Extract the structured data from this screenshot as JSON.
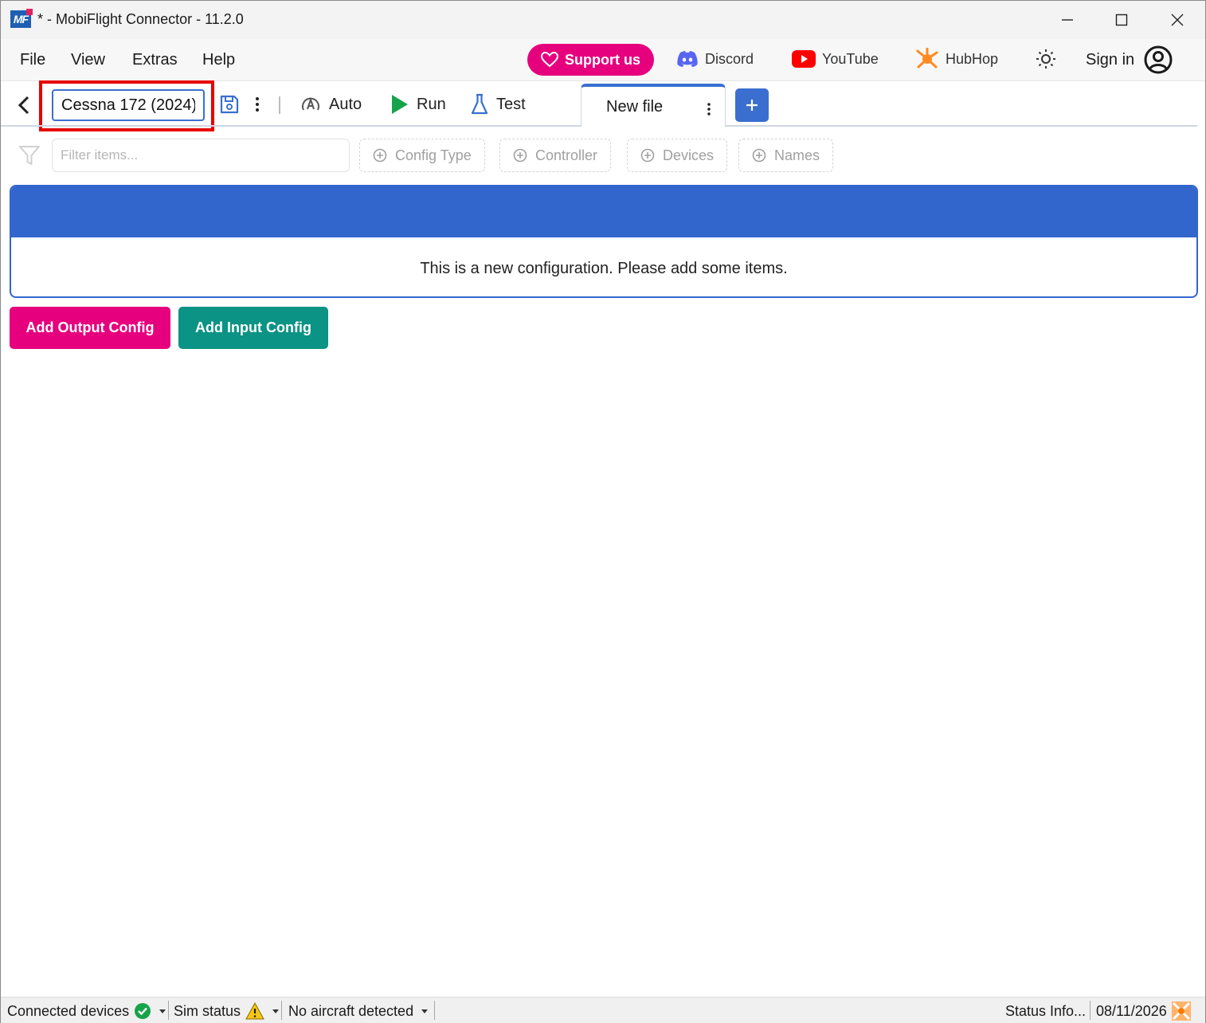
{
  "window": {
    "title": "* - MobiFlight Connector - 11.2.0",
    "logo_text": "MF"
  },
  "menu": {
    "items": [
      "File",
      "View",
      "Extras",
      "Help"
    ],
    "support_label": "Support us",
    "links": [
      {
        "label": "Discord",
        "icon": "discord-icon"
      },
      {
        "label": "YouTube",
        "icon": "youtube-icon"
      },
      {
        "label": "HubHop",
        "icon": "hubhop-icon"
      }
    ],
    "sign_in_label": "Sign in"
  },
  "toolbar": {
    "project_name_value": "Cessna 172 (2024)",
    "auto_label": "Auto",
    "run_label": "Run",
    "test_label": "Test",
    "file_tab_label": "New file"
  },
  "filters": {
    "filter_placeholder": "Filter items...",
    "chips": [
      "Config Type",
      "Controller",
      "Devices",
      "Names"
    ]
  },
  "config": {
    "empty_message": "This is a new configuration. Please add some items.",
    "add_output_label": "Add Output Config",
    "add_input_label": "Add Input Config"
  },
  "statusbar": {
    "connected_devices": "Connected devices",
    "sim_status": "Sim status",
    "aircraft": "No aircraft detected",
    "status_info": "Status Info...",
    "date": "08/11/2026"
  },
  "colors": {
    "accent_blue": "#3366cc",
    "support_pink": "#e6007e",
    "input_teal": "#0b9385",
    "highlight_red": "#e60000"
  }
}
